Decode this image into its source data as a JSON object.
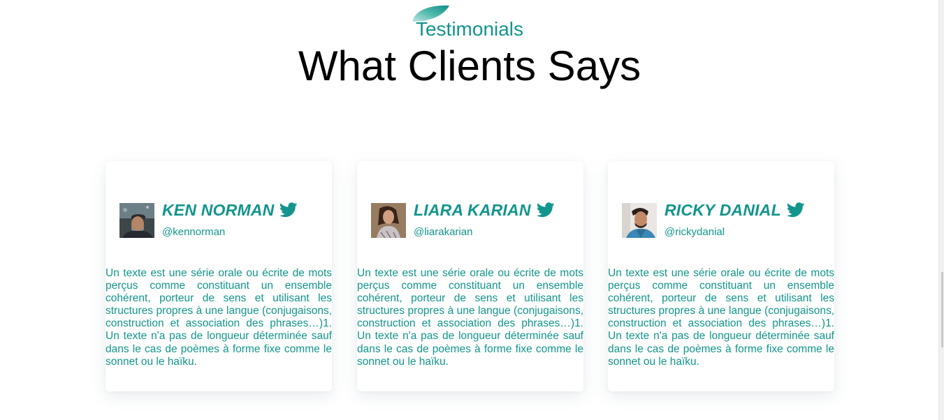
{
  "header": {
    "eyebrow": "Testimonials",
    "title": "What Clients Says"
  },
  "colors": {
    "accent": "#12958c",
    "heading": "#000000",
    "card_background": "#ffffff"
  },
  "testimonials": [
    {
      "name": "KEN NORMAN",
      "handle": "@kennorman",
      "icon": "twitter-icon",
      "text": "Un texte est une série orale ou écrite de mots perçus comme constituant un ensemble cohérent, porteur de sens et utilisant les structures propres à une langue (conjugaisons, construction et association des phrases…)1. Un texte n'a pas de longueur déterminée sauf dans le cas de poèmes à forme fixe comme le sonnet ou le haïku."
    },
    {
      "name": "LIARA KARIAN",
      "handle": "@liarakarian",
      "icon": "twitter-icon",
      "text": "Un texte est une série orale ou écrite de mots perçus comme constituant un ensemble cohérent, porteur de sens et utilisant les structures propres à une langue (conjugaisons, construction et association des phrases…)1. Un texte n'a pas de longueur déterminée sauf dans le cas de poèmes à forme fixe comme le sonnet ou le haïku."
    },
    {
      "name": "RICKY DANIAL",
      "handle": "@rickydanial",
      "icon": "twitter-icon",
      "text": "Un texte est une série orale ou écrite de mots perçus comme constituant un ensemble cohérent, porteur de sens et utilisant les structures propres à une langue (conjugaisons, construction et association des phrases…)1. Un texte n'a pas de longueur déterminée sauf dans le cas de poèmes à forme fixe comme le sonnet ou le haïku."
    }
  ]
}
